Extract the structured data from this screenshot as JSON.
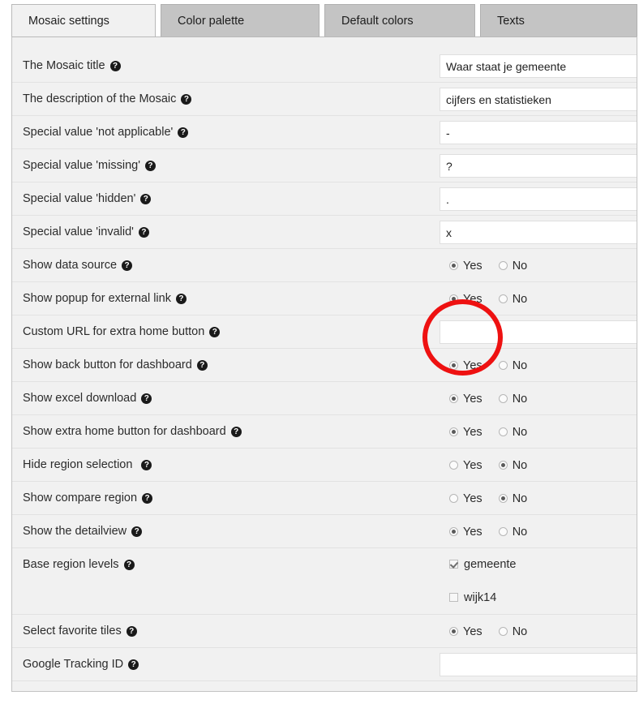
{
  "tabs": [
    {
      "label": "Mosaic settings",
      "active": true
    },
    {
      "label": "Color palette",
      "active": false
    },
    {
      "label": "Default colors",
      "active": false
    },
    {
      "label": "Texts",
      "active": false
    }
  ],
  "help_glyph": "?",
  "radio_labels": {
    "yes": "Yes",
    "no": "No"
  },
  "accent_annotation_color": "#ee1111",
  "rows": [
    {
      "label": "The Mosaic title",
      "type": "text",
      "value": "Waar staat je gemeente",
      "placeholder": ""
    },
    {
      "label": "The description of the Mosaic",
      "type": "text",
      "value": "cijfers en statistieken",
      "placeholder": ""
    },
    {
      "label": "Special value 'not applicable'",
      "type": "text",
      "value": "-",
      "placeholder": ""
    },
    {
      "label": "Special value 'missing'",
      "type": "text",
      "value": "?",
      "placeholder": ""
    },
    {
      "label": "Special value 'hidden'",
      "type": "text",
      "value": ".",
      "placeholder": ""
    },
    {
      "label": "Special value 'invalid'",
      "type": "text",
      "value": "x",
      "placeholder": ""
    },
    {
      "label": "Show data source",
      "type": "radio",
      "selected": "Yes"
    },
    {
      "label": "Show popup for external link",
      "type": "radio",
      "selected": "Yes"
    },
    {
      "label": "Custom URL for extra home button",
      "type": "text",
      "value": "",
      "placeholder": ""
    },
    {
      "label": "Show back button for dashboard",
      "type": "radio",
      "selected": "Yes"
    },
    {
      "label": "Show excel download",
      "type": "radio",
      "selected": "Yes"
    },
    {
      "label": "Show extra home button for dashboard",
      "type": "radio",
      "selected": "Yes"
    },
    {
      "label": "Hide region selection",
      "type": "radio",
      "selected": "No",
      "extra_gap": true
    },
    {
      "label": "Show compare region",
      "type": "radio",
      "selected": "No"
    },
    {
      "label": "Show the detailview",
      "type": "radio",
      "selected": "Yes"
    },
    {
      "label": "Base region levels",
      "type": "checkbox",
      "options": [
        {
          "label": "gemeente",
          "checked": true
        },
        {
          "label": "wijk14",
          "checked": false
        }
      ]
    },
    {
      "label": "Select favorite tiles",
      "type": "radio",
      "selected": "Yes"
    },
    {
      "label": "Google Tracking ID",
      "type": "text",
      "value": "",
      "placeholder": "",
      "bounded": true
    }
  ]
}
